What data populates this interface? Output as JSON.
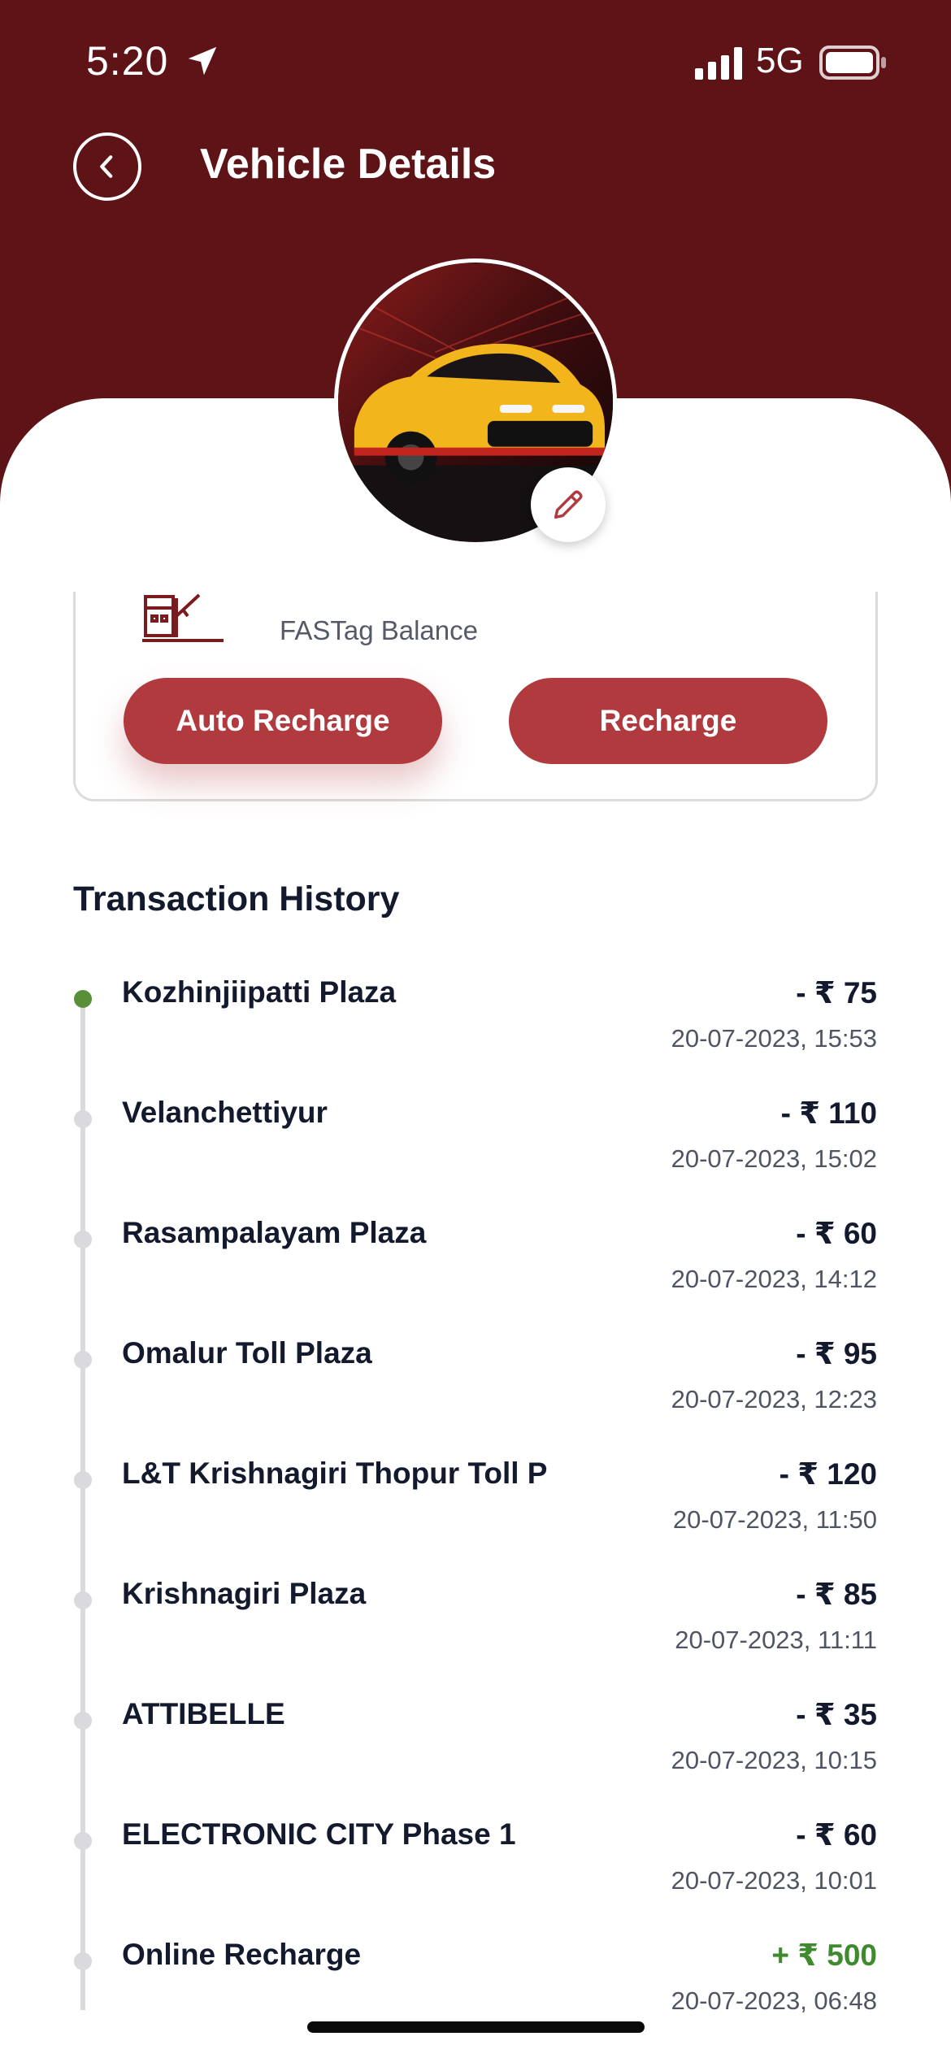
{
  "status_bar": {
    "time": "5:20",
    "network": "5G"
  },
  "header": {
    "title": "Vehicle Details"
  },
  "card": {
    "fastag_label": "FASTag Balance",
    "auto_recharge_label": "Auto Recharge",
    "recharge_label": "Recharge"
  },
  "history": {
    "title": "Transaction History",
    "items": [
      {
        "name": "Kozhinjiipatti Plaza",
        "amount": "- ₹ 75",
        "time": "20-07-2023, 15:53"
      },
      {
        "name": "Velanchettiyur",
        "amount": "- ₹ 110",
        "time": "20-07-2023, 15:02"
      },
      {
        "name": "Rasampalayam Plaza",
        "amount": "- ₹ 60",
        "time": "20-07-2023, 14:12"
      },
      {
        "name": "Omalur Toll Plaza",
        "amount": "- ₹ 95",
        "time": "20-07-2023, 12:23"
      },
      {
        "name": "L&T Krishnagiri Thopur Toll P",
        "amount": "- ₹ 120",
        "time": "20-07-2023, 11:50"
      },
      {
        "name": "Krishnagiri Plaza",
        "amount": "- ₹ 85",
        "time": "20-07-2023, 11:11"
      },
      {
        "name": "ATTIBELLE",
        "amount": "- ₹ 35",
        "time": "20-07-2023, 10:15"
      },
      {
        "name": "ELECTRONIC  CITY Phase 1",
        "amount": "- ₹ 60",
        "time": "20-07-2023, 10:01"
      },
      {
        "name": "Online Recharge",
        "amount": "+ ₹ 500",
        "time": "20-07-2023, 06:48"
      }
    ]
  },
  "colors": {
    "header_bg": "#5e1317",
    "button_red": "#b03a3d",
    "credit_green": "#3f8a2f",
    "active_dot": "#5a8f3a"
  },
  "icons": [
    "location-arrow-icon",
    "signal-icon",
    "battery-icon",
    "back-arrow-icon",
    "pencil-icon",
    "toll-gate-icon"
  ]
}
